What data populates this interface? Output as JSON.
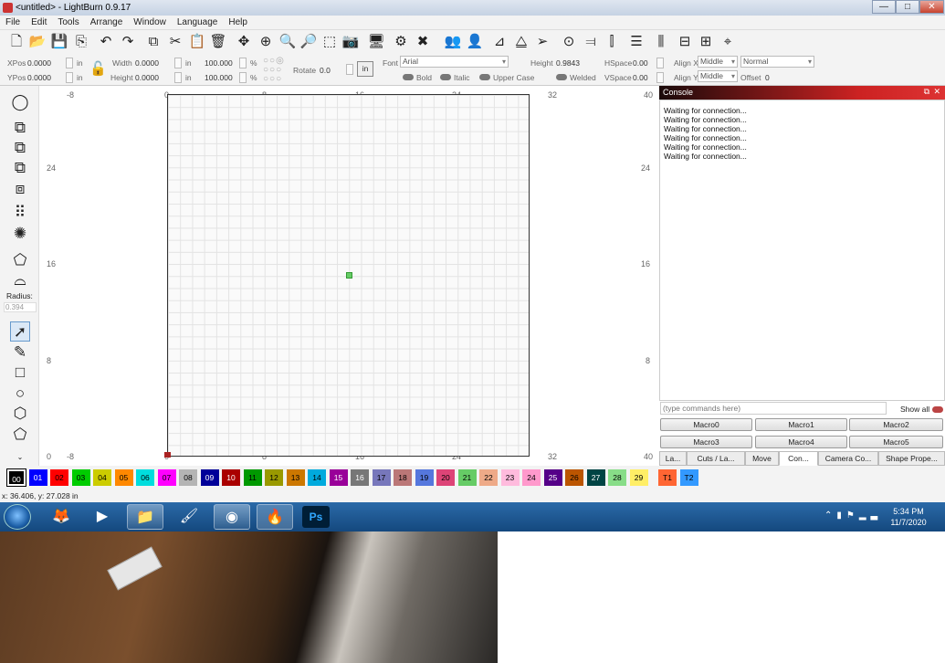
{
  "window": {
    "title": "<untitled> - LightBurn 0.9.17",
    "min": "—",
    "max": "□",
    "close": "✕"
  },
  "menu": [
    "File",
    "Edit",
    "Tools",
    "Arrange",
    "Window",
    "Language",
    "Help"
  ],
  "props": {
    "xpos_label": "XPos",
    "xpos": "0.0000",
    "ypos_label": "YPos",
    "ypos": "0.0000",
    "unit": "in",
    "width_label": "Width",
    "width": "0.0000",
    "height_label": "Height",
    "height": "0.0000",
    "scale_w": "100.000",
    "scale_h": "100.000",
    "pct": "%",
    "rotate_label": "Rotate",
    "rotate": "0.0",
    "in_button": "in",
    "font_label": "Font",
    "font": "Arial",
    "bold": "Bold",
    "italic": "Italic",
    "upper": "Upper Case",
    "welded": "Welded",
    "text_height_label": "Height",
    "text_height": "0.9843",
    "hspace_label": "HSpace",
    "hspace": "0.00",
    "vspace_label": "VSpace",
    "vspace": "0.00",
    "alignx_label": "Align X",
    "alignx": "Middle",
    "aligny_label": "Align Y",
    "aligny": "Middle",
    "mode": "Normal",
    "offset_label": "Offset",
    "offset": "0"
  },
  "left": {
    "radius_label": "Radius:",
    "radius": "0.394"
  },
  "rulers": {
    "top": [
      "-8",
      "0",
      "8",
      "16",
      "24",
      "32",
      "40"
    ],
    "left": [
      "24",
      "16",
      "8",
      "0"
    ],
    "right": [
      "24",
      "16",
      "8"
    ],
    "bottom": [
      "-8",
      "0",
      "8",
      "16",
      "24",
      "32",
      "40"
    ]
  },
  "console": {
    "title": "Console",
    "lines": [
      "Waiting for connection...",
      "Waiting for connection...",
      "Waiting for connection...",
      "Waiting for connection...",
      "Waiting for connection...",
      "Waiting for connection..."
    ],
    "cmd_placeholder": "(type commands here)",
    "show_all": "Show all",
    "macros": [
      "Macro0",
      "Macro1",
      "Macro2",
      "Macro3",
      "Macro4",
      "Macro5"
    ]
  },
  "tabs": [
    "La...",
    "Cuts / La...",
    "Move",
    "Con...",
    "Camera Co...",
    "Shape Prope..."
  ],
  "palette": [
    {
      "l": "00",
      "c": "#000000"
    },
    {
      "l": "01",
      "c": "#0000ff"
    },
    {
      "l": "02",
      "c": "#ff0000"
    },
    {
      "l": "03",
      "c": "#00cc00"
    },
    {
      "l": "04",
      "c": "#cccc00"
    },
    {
      "l": "05",
      "c": "#ff8800"
    },
    {
      "l": "06",
      "c": "#00dddd"
    },
    {
      "l": "07",
      "c": "#ff00ff"
    },
    {
      "l": "08",
      "c": "#b4b4b4"
    },
    {
      "l": "09",
      "c": "#000099"
    },
    {
      "l": "10",
      "c": "#aa0000"
    },
    {
      "l": "11",
      "c": "#009900"
    },
    {
      "l": "12",
      "c": "#999900"
    },
    {
      "l": "13",
      "c": "#cc7700"
    },
    {
      "l": "14",
      "c": "#00aadd"
    },
    {
      "l": "15",
      "c": "#990099"
    },
    {
      "l": "16",
      "c": "#777777"
    },
    {
      "l": "17",
      "c": "#7777bb"
    },
    {
      "l": "18",
      "c": "#bb7777"
    },
    {
      "l": "19",
      "c": "#5577dd"
    },
    {
      "l": "20",
      "c": "#dd4477"
    },
    {
      "l": "21",
      "c": "#66cc66"
    },
    {
      "l": "22",
      "c": "#eeaa88"
    },
    {
      "l": "23",
      "c": "#ffbbdd"
    },
    {
      "l": "24",
      "c": "#ff99cc"
    },
    {
      "l": "25",
      "c": "#550088"
    },
    {
      "l": "26",
      "c": "#bb5500"
    },
    {
      "l": "27",
      "c": "#004444"
    },
    {
      "l": "28",
      "c": "#88dd88"
    },
    {
      "l": "29",
      "c": "#ffee66"
    },
    {
      "l": "T1",
      "c": "#ff6633"
    },
    {
      "l": "T2",
      "c": "#3399ff"
    }
  ],
  "status": {
    "coords": "x: 36.406, y: 27.028 in"
  },
  "taskbar": {
    "time": "5:34 PM",
    "date": "11/7/2020"
  }
}
